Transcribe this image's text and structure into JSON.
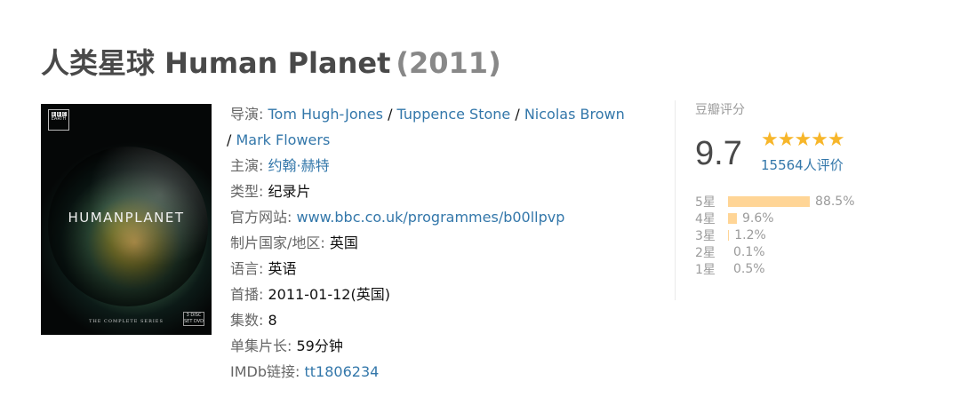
{
  "title": {
    "name": "人类星球 Human Planet",
    "year": "(2011)"
  },
  "poster": {
    "brand": "EARTH",
    "bbc_letters": [
      "B",
      "B",
      "C"
    ],
    "title": "HUMANPLANET",
    "series": "THE COMPLETE SERIES",
    "dvd": "3 DISC SET DVD"
  },
  "info": {
    "director_label": "导演:",
    "directors": [
      "Tom Hugh-Jones",
      "Tuppence Stone",
      "Nicolas Brown",
      "Mark Flowers"
    ],
    "separator": " / ",
    "cast_label": "主演:",
    "cast": "约翰·赫特",
    "genre_label": "类型:",
    "genre": "纪录片",
    "website_label": "官方网站:",
    "website": "www.bbc.co.uk/programmes/b00llpvp",
    "country_label": "制片国家/地区:",
    "country": "英国",
    "language_label": "语言:",
    "language": "英语",
    "premiere_label": "首播:",
    "premiere": "2011-01-12(英国)",
    "episodes_label": "集数:",
    "episodes": "8",
    "runtime_label": "单集片长:",
    "runtime": "59分钟",
    "imdb_label": "IMDb链接:",
    "imdb": "tt1806234"
  },
  "rating": {
    "label": "豆瓣评分",
    "score": "9.7",
    "stars_icon": "★★★★★",
    "stars_value": 5,
    "votes": "15564人评价",
    "breakdown": [
      {
        "label": "5星",
        "pct": "88.5%",
        "value": 88.5
      },
      {
        "label": "4星",
        "pct": "9.6%",
        "value": 9.6
      },
      {
        "label": "3星",
        "pct": "1.2%",
        "value": 1.2
      },
      {
        "label": "2星",
        "pct": "0.1%",
        "value": 0.1
      },
      {
        "label": "1星",
        "pct": "0.5%",
        "value": 0.5
      }
    ],
    "bar_color": "#ffd596",
    "star_color": "#f7b62a",
    "link_color": "#3377aa"
  }
}
